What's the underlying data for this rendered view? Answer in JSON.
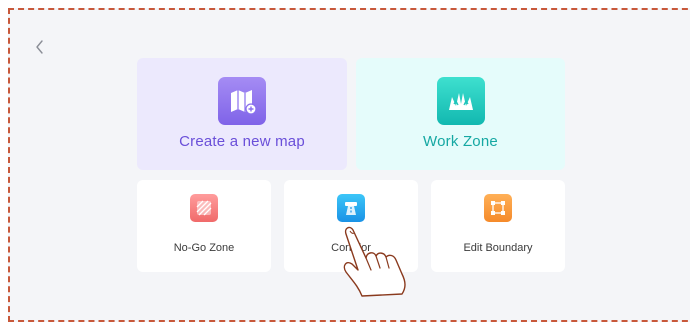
{
  "nav": {
    "back_icon": "chevron-left-icon"
  },
  "menu": {
    "create_map": {
      "label": "Create a new map",
      "icon": "map-add-icon",
      "color": "#6a4fd9",
      "background": "#ece9fd"
    },
    "work_zone": {
      "label": "Work Zone",
      "icon": "grass-icon",
      "color": "#16a8a3",
      "background": "#e5fcfb"
    },
    "no_go_zone": {
      "label": "No-Go Zone",
      "icon": "hatched-square-icon",
      "color": "#f06a6a"
    },
    "corridor": {
      "label": "Corridor",
      "icon": "corridor-icon",
      "color": "#1a92e6"
    },
    "edit_boundary": {
      "label": "Edit Boundary",
      "icon": "boundary-edit-icon",
      "color": "#f58a2a"
    }
  },
  "overlay": {
    "pointer": "tapping-hand-icon"
  },
  "colors": {
    "frame_border": "#c8583a",
    "background": "#f4f5f8"
  }
}
